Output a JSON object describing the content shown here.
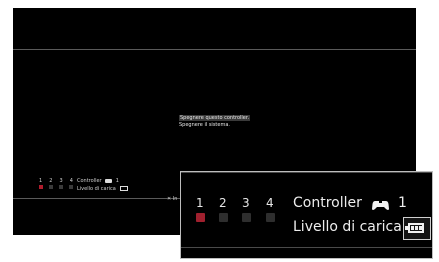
{
  "dialog": {
    "option_1": "Spegnere questo controller.",
    "option_2": "Spegnere il sistema."
  },
  "controller_panel": {
    "port_numbers": [
      "1",
      "2",
      "3",
      "4"
    ],
    "active_port": 1,
    "controller_label": "Controller",
    "controller_number": "1",
    "charge_label": "Livello di carica",
    "battery_level_bars": 3,
    "battery_level_max": 3
  },
  "footer": {
    "hint_partial": "✕ In"
  },
  "colors": {
    "background": "#000000",
    "active_port": "#a0202e",
    "inactive_port": "#2e2e2e",
    "text": "#ededed"
  },
  "icons": {
    "controller": "gamepad-icon",
    "battery": "battery-icon",
    "cross_button": "cross-button-icon"
  }
}
